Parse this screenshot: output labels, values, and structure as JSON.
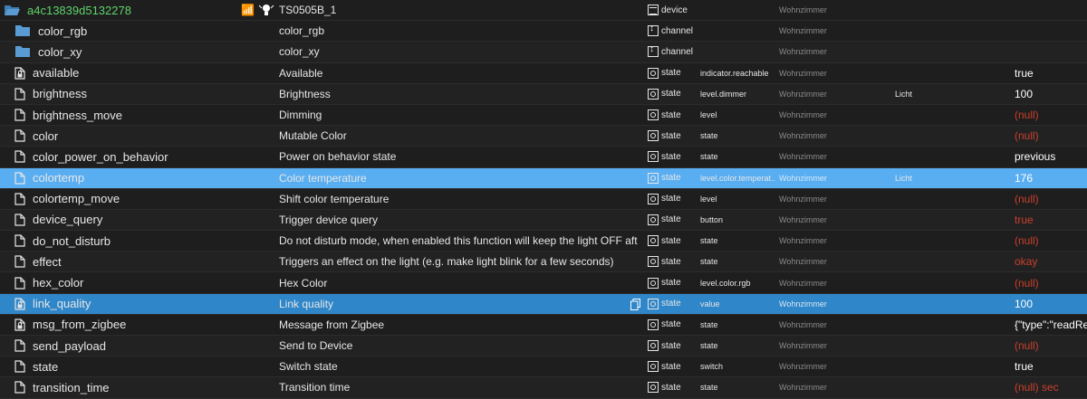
{
  "header": {
    "id": "a4c13839d5132278",
    "name": "TS0505B_1",
    "type": "device",
    "room": "Wohnzimmer"
  },
  "rows": [
    {
      "id": "color_rgb",
      "name": "color_rgb",
      "type": "channel",
      "role": "",
      "room": "Wohnzimmer",
      "function": "",
      "value": "",
      "kind": "folder",
      "null": false
    },
    {
      "id": "color_xy",
      "name": "color_xy",
      "type": "channel",
      "role": "",
      "room": "Wohnzimmer",
      "function": "",
      "value": "",
      "kind": "folder",
      "null": false
    },
    {
      "id": "available",
      "name": "Available",
      "type": "state",
      "role": "indicator.reachable",
      "room": "Wohnzimmer",
      "function": "",
      "value": "true",
      "kind": "file-lock",
      "null": false
    },
    {
      "id": "brightness",
      "name": "Brightness",
      "type": "state",
      "role": "level.dimmer",
      "room": "Wohnzimmer",
      "function": "Licht",
      "value": "100",
      "kind": "file",
      "null": false
    },
    {
      "id": "brightness_move",
      "name": "Dimming",
      "type": "state",
      "role": "level",
      "room": "Wohnzimmer",
      "function": "",
      "value": "(null)",
      "kind": "file",
      "null": true
    },
    {
      "id": "color",
      "name": "Mutable Color",
      "type": "state",
      "role": "state",
      "room": "Wohnzimmer",
      "function": "",
      "value": "(null)",
      "kind": "file",
      "null": true
    },
    {
      "id": "color_power_on_behavior",
      "name": "Power on behavior state",
      "type": "state",
      "role": "state",
      "room": "Wohnzimmer",
      "function": "",
      "value": "previous",
      "kind": "file",
      "null": false
    },
    {
      "id": "colortemp",
      "name": "Color temperature",
      "type": "state",
      "role": "level.color.temperat...",
      "room": "Wohnzimmer",
      "function": "Licht",
      "value": "176",
      "kind": "file",
      "null": false,
      "selected": "light"
    },
    {
      "id": "colortemp_move",
      "name": "Shift color temperature",
      "type": "state",
      "role": "level",
      "room": "Wohnzimmer",
      "function": "",
      "value": "(null)",
      "kind": "file",
      "null": true
    },
    {
      "id": "device_query",
      "name": "Trigger device query",
      "type": "state",
      "role": "button",
      "room": "Wohnzimmer",
      "function": "",
      "value": "true",
      "kind": "file",
      "null": true
    },
    {
      "id": "do_not_disturb",
      "name": "Do not disturb mode, when enabled this function will keep the light OFF after a power ou...",
      "type": "state",
      "role": "state",
      "room": "Wohnzimmer",
      "function": "",
      "value": "(null)",
      "kind": "file",
      "null": true
    },
    {
      "id": "effect",
      "name": "Triggers an effect on the light (e.g. make light blink for a few seconds)",
      "type": "state",
      "role": "state",
      "room": "Wohnzimmer",
      "function": "",
      "value": "okay",
      "kind": "file",
      "null": true
    },
    {
      "id": "hex_color",
      "name": "Hex Color",
      "type": "state",
      "role": "level.color.rgb",
      "room": "Wohnzimmer",
      "function": "",
      "value": "(null)",
      "kind": "file",
      "null": true
    },
    {
      "id": "link_quality",
      "name": "Link quality",
      "type": "state",
      "role": "value",
      "room": "Wohnzimmer",
      "function": "",
      "value": "100",
      "kind": "file-lock",
      "null": false,
      "selected": "dark"
    },
    {
      "id": "msg_from_zigbee",
      "name": "Message from Zigbee",
      "type": "state",
      "role": "state",
      "room": "Wohnzimmer",
      "function": "",
      "value": "{\"type\":\"readRes",
      "kind": "file-lock",
      "null": false
    },
    {
      "id": "send_payload",
      "name": "Send to Device",
      "type": "state",
      "role": "state",
      "room": "Wohnzimmer",
      "function": "",
      "value": "(null)",
      "kind": "file",
      "null": true
    },
    {
      "id": "state",
      "name": "Switch state",
      "type": "state",
      "role": "switch",
      "room": "Wohnzimmer",
      "function": "",
      "value": "true",
      "kind": "file",
      "null": false
    },
    {
      "id": "transition_time",
      "name": "Transition time",
      "type": "state",
      "role": "state",
      "room": "Wohnzimmer",
      "function": "",
      "value": "(null) sec",
      "kind": "file",
      "null": true
    }
  ],
  "colors": {
    "accent_green": "#5fd36a",
    "null_red": "#c8402c",
    "selected_light": "#59aef2",
    "selected_dark": "#2f86c8"
  }
}
